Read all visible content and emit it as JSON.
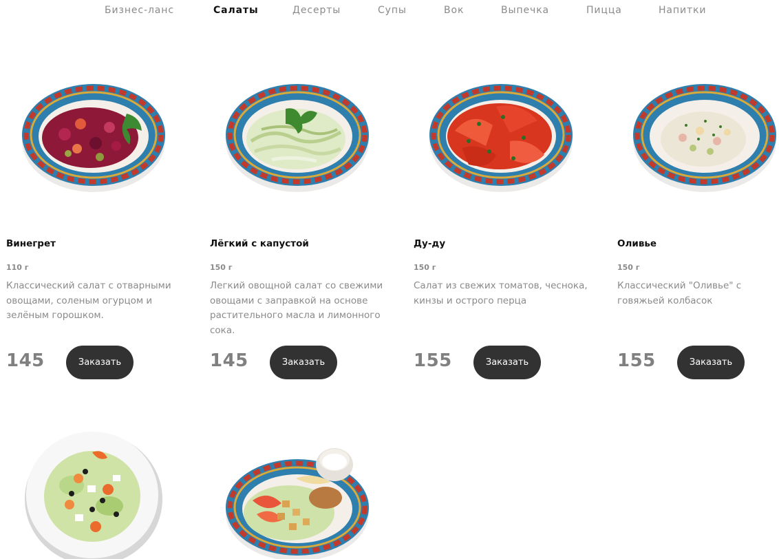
{
  "nav": {
    "items": [
      {
        "label": "Бизнес-ланс",
        "active": false
      },
      {
        "label": "Салаты",
        "active": true
      },
      {
        "label": "Десерты",
        "active": false
      },
      {
        "label": "Супы",
        "active": false
      },
      {
        "label": "Вок",
        "active": false
      },
      {
        "label": "Выпечка",
        "active": false
      },
      {
        "label": "Пицца",
        "active": false
      },
      {
        "label": "Напитки",
        "active": false
      }
    ]
  },
  "products": [
    {
      "name": "Винегрет",
      "weight": "110 г",
      "description": "Классический салат с отварными овощами, соленым огурцом и зелёным горошком.",
      "price": "145",
      "button": "Заказать",
      "image": "vinegret-salad-plate"
    },
    {
      "name": "Лёгкий с капустой",
      "weight": "150 г",
      "description": "Легкий овощной салат со свежими овощами с заправкой на основе растительного масла и лимонного сока.",
      "price": "145",
      "button": "Заказать",
      "image": "cabbage-salad-plate"
    },
    {
      "name": "Ду-ду",
      "weight": "150 г",
      "description": "Салат из свежих томатов, чеснока, кинзы и острого перца",
      "price": "155",
      "button": "Заказать",
      "image": "tomato-salad-plate"
    },
    {
      "name": "Оливье",
      "weight": "150 г",
      "description": "Классический \"Оливье\" с говяжьей колбасок",
      "price": "155",
      "button": "Заказать",
      "image": "olivier-salad-plate"
    },
    {
      "image": "greek-salad-plate"
    },
    {
      "image": "caesar-salad-plate"
    }
  ],
  "colors": {
    "accent": "#323232",
    "active_tab": "#111111",
    "muted_text": "#8a8a8a",
    "price": "#808080",
    "plate_rim": "#2e7fae",
    "plate_red": "#c23a2b",
    "plate_gold": "#d9a93a"
  }
}
